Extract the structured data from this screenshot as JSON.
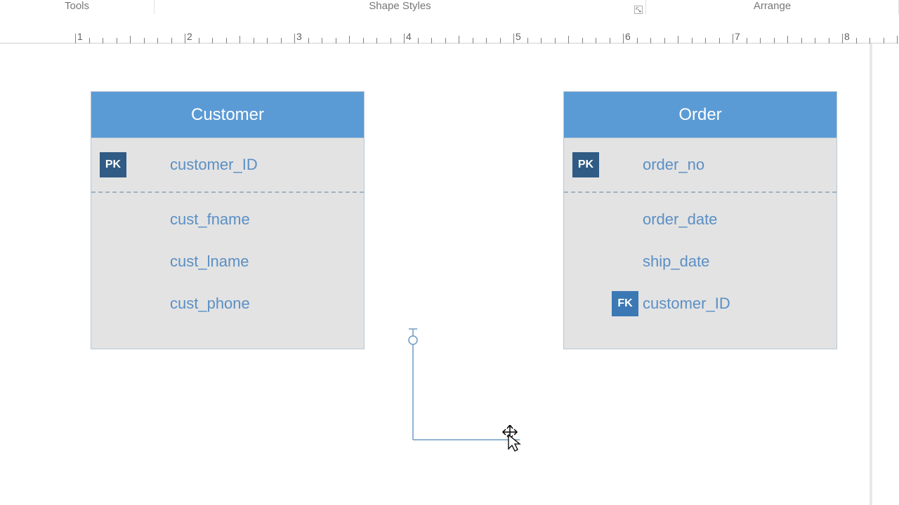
{
  "ribbon": {
    "tools": "Tools",
    "shape_styles": "Shape Styles",
    "arrange": "Arrange"
  },
  "ruler": {
    "labels": [
      "1",
      "2",
      "3",
      "4",
      "5",
      "6",
      "7",
      "8"
    ]
  },
  "entities": {
    "customer": {
      "title": "Customer",
      "pk_badge": "PK",
      "pk_field": "customer_ID",
      "f1": "cust_fname",
      "f2": "cust_lname",
      "f3": "cust_phone"
    },
    "order": {
      "title": "Order",
      "pk_badge": "PK",
      "pk_field": "order_no",
      "f1": "order_date",
      "f2": "ship_date",
      "fk_badge": "FK",
      "fk_field": "customer_ID"
    }
  }
}
